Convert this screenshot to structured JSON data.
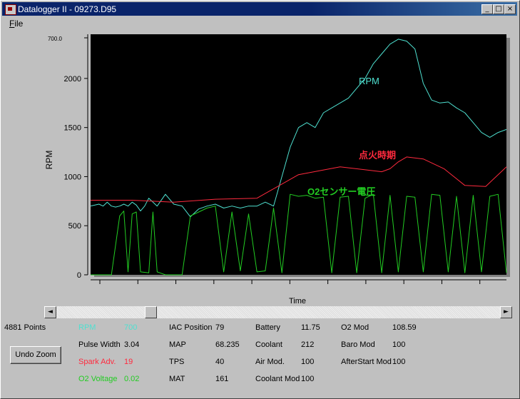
{
  "window": {
    "title": "Datalogger II - 09273.D95",
    "minimize": "_",
    "maximize": "□",
    "close": "×"
  },
  "menu": {
    "file_hotkey": "F",
    "file_rest": "ile"
  },
  "colors": {
    "rpm": "#4ee0d0",
    "spark": "#ff2a3e",
    "o2": "#22cc22",
    "plot_bg": "#000000"
  },
  "chart_data": {
    "type": "line",
    "ylabel": "RPM",
    "xlabel": "Time",
    "ylim": [
      0,
      2450
    ],
    "yticks": [
      "0",
      "500",
      "1000",
      "1500",
      "2000"
    ],
    "ytop_label": "700.0",
    "series": [
      {
        "name": "RPM",
        "color": "#4ee0d0",
        "x": [
          0,
          2,
          3,
          4,
          5,
          6,
          7,
          8,
          9,
          10,
          11,
          12,
          13,
          14,
          16,
          18,
          20,
          22,
          24,
          26,
          28,
          30,
          32,
          34,
          36,
          38,
          40,
          42,
          44,
          46,
          48,
          50,
          52,
          54,
          56,
          58,
          60,
          62,
          64,
          66,
          68,
          70,
          72,
          74,
          76,
          78,
          80,
          82,
          84,
          86,
          88,
          90,
          92,
          94,
          96,
          98,
          100
        ],
        "values": [
          700,
          720,
          700,
          740,
          700,
          690,
          700,
          720,
          700,
          740,
          710,
          650,
          700,
          780,
          700,
          820,
          720,
          700,
          590,
          670,
          700,
          720,
          680,
          700,
          680,
          700,
          700,
          740,
          700,
          1000,
          1300,
          1500,
          1550,
          1500,
          1650,
          1700,
          1750,
          1800,
          1900,
          2000,
          2150,
          2250,
          2350,
          2400,
          2380,
          2300,
          1950,
          1780,
          1750,
          1760,
          1700,
          1650,
          1550,
          1450,
          1400,
          1450,
          1480
        ]
      },
      {
        "name": "点火時期",
        "color": "#ff2a3e",
        "x": [
          0,
          10,
          20,
          30,
          40,
          50,
          60,
          70,
          72,
          74,
          76,
          80,
          85,
          90,
          95,
          100
        ],
        "values": [
          760,
          760,
          740,
          770,
          780,
          1020,
          1100,
          1050,
          1080,
          1150,
          1200,
          1180,
          1080,
          910,
          900,
          1100
        ]
      },
      {
        "name": "O2センサー電圧",
        "color": "#22cc22",
        "x": [
          0,
          5,
          7,
          8,
          9,
          10,
          11,
          12,
          14,
          15,
          16,
          18,
          20,
          22,
          24,
          26,
          28,
          30,
          32,
          34,
          36,
          38,
          40,
          42,
          44,
          46,
          48,
          50,
          52,
          54,
          56,
          58,
          60,
          62,
          64,
          66,
          68,
          70,
          72,
          74,
          76,
          78,
          80,
          82,
          84,
          86,
          88,
          90,
          92,
          94,
          96,
          98,
          100
        ],
        "values": [
          0,
          0,
          600,
          650,
          30,
          620,
          640,
          30,
          20,
          640,
          30,
          0,
          0,
          0,
          600,
          640,
          680,
          700,
          30,
          640,
          40,
          620,
          30,
          40,
          680,
          20,
          820,
          800,
          810,
          780,
          790,
          20,
          790,
          800,
          20,
          780,
          820,
          20,
          810,
          30,
          800,
          790,
          30,
          820,
          810,
          30,
          800,
          20,
          810,
          30,
          800,
          820,
          20
        ]
      }
    ]
  },
  "scrollbar": {
    "left_arrow": "◄",
    "right_arrow": "►",
    "position": 0.2
  },
  "stats": {
    "points": "4881 Points",
    "undo_zoom": "Undo Zoom",
    "col1": [
      {
        "label": "RPM",
        "value": "700",
        "color": "#4ee0d0"
      },
      {
        "label": "Pulse Width",
        "value": "3.04",
        "color": "#000000"
      },
      {
        "label": "Spark Adv.",
        "value": "19",
        "color": "#ff2a3e"
      },
      {
        "label": "O2 Voltage",
        "value": "0.02",
        "color": "#22cc22"
      }
    ],
    "col2": [
      {
        "label": "IAC Position",
        "value": "79"
      },
      {
        "label": "MAP",
        "value": "68.235"
      },
      {
        "label": "TPS",
        "value": "40"
      },
      {
        "label": "MAT",
        "value": "161"
      }
    ],
    "col3": [
      {
        "label": "Battery",
        "value": "11.75"
      },
      {
        "label": "Coolant",
        "value": "212"
      },
      {
        "label": "Air Mod.",
        "value": "100"
      },
      {
        "label": "Coolant Mod",
        "value": "100"
      }
    ],
    "col4": [
      {
        "label": "O2 Mod",
        "value": "108.59"
      },
      {
        "label": "Baro Mod",
        "value": "100"
      },
      {
        "label": "AfterStart Mod",
        "value": "100"
      }
    ]
  }
}
